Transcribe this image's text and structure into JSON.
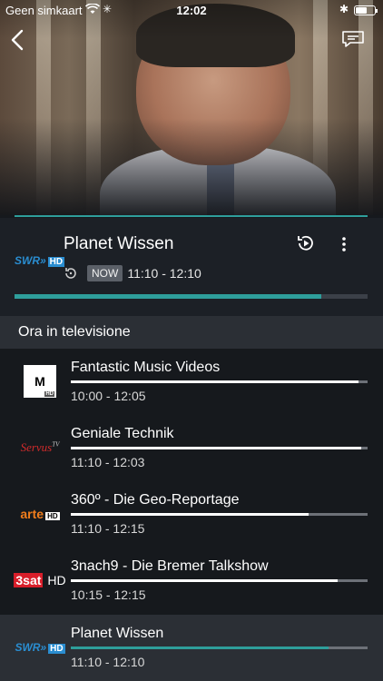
{
  "status_bar": {
    "carrier": "Geen simkaart",
    "time": "12:02"
  },
  "now_playing": {
    "channel_logo": "SWR»HD",
    "channel_logo_hd": "HD",
    "channel_logo_main": "SWR»",
    "title": "Planet Wissen",
    "badge": "NOW",
    "time": "11:10 - 12:10",
    "progress": 0.87
  },
  "section": {
    "title": "Ora in televisione"
  },
  "channels": [
    {
      "logo_text": "M",
      "logo_sub": "HD",
      "title": "Fantastic Music Videos",
      "time": "10:00 - 12:05",
      "progress": 0.97,
      "active": false
    },
    {
      "logo_text": "Servus",
      "logo_sub": "TV",
      "title": "Geniale Technik",
      "time": "11:10 - 12:03",
      "progress": 0.98,
      "active": false
    },
    {
      "logo_text": "arte",
      "logo_sub": "HD",
      "title": "360º - Die Geo-Reportage",
      "time": "11:10 - 12:15",
      "progress": 0.8,
      "active": false
    },
    {
      "logo_text": "3sat",
      "logo_sub": "HD",
      "title": "3nach9 - Die Bremer Talkshow",
      "time": "10:15 - 12:15",
      "progress": 0.9,
      "active": false
    },
    {
      "logo_text": "SWR»",
      "logo_sub": "HD",
      "title": "Planet Wissen",
      "time": "11:10 - 12:10",
      "progress": 0.87,
      "active": true
    }
  ],
  "colors": {
    "accent": "#2e9e9b",
    "background": "#16191d",
    "card": "#1c2026",
    "header": "#2b2f35"
  },
  "icons": {
    "back": "chevron-left-icon",
    "chat": "chat-bubble-icon",
    "restart": "restart-icon",
    "more": "more-vertical-icon"
  }
}
